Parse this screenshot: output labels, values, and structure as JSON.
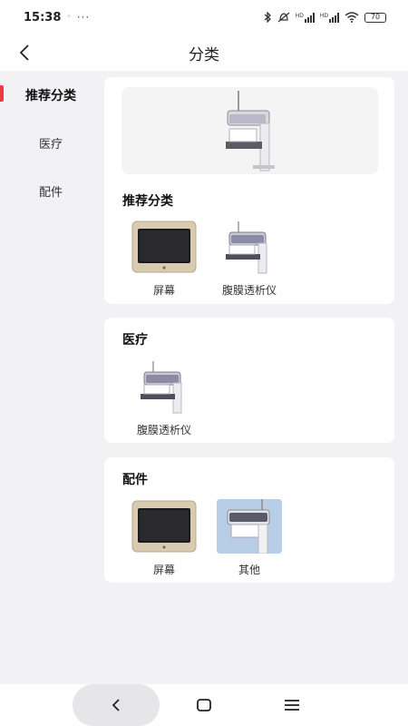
{
  "status_bar": {
    "time": "15:38",
    "dot": "◦",
    "more": "···",
    "hd1": "HD",
    "hd2": "HD",
    "battery": "70"
  },
  "nav": {
    "title": "分类"
  },
  "sidebar": {
    "items": [
      {
        "label": "推荐分类",
        "active": true
      },
      {
        "label": "医疗",
        "active": false
      },
      {
        "label": "配件",
        "active": false
      }
    ]
  },
  "sections": {
    "recommended": {
      "title": "推荐分类",
      "items": [
        {
          "label": "屏幕",
          "icon": "screen-product-icon"
        },
        {
          "label": "腹膜透析仪",
          "icon": "dialysis-machine-icon"
        }
      ]
    },
    "medical": {
      "title": "医疗",
      "items": [
        {
          "label": "腹膜透析仪",
          "icon": "dialysis-machine-icon"
        }
      ]
    },
    "accessories": {
      "title": "配件",
      "items": [
        {
          "label": "屏幕",
          "icon": "screen-product-icon"
        },
        {
          "label": "其他",
          "icon": "other-product-icon"
        }
      ]
    }
  },
  "colors": {
    "accent_indicator": "#ee3b3b",
    "page_background": "#f2f2f4",
    "card_background": "#ffffff"
  }
}
